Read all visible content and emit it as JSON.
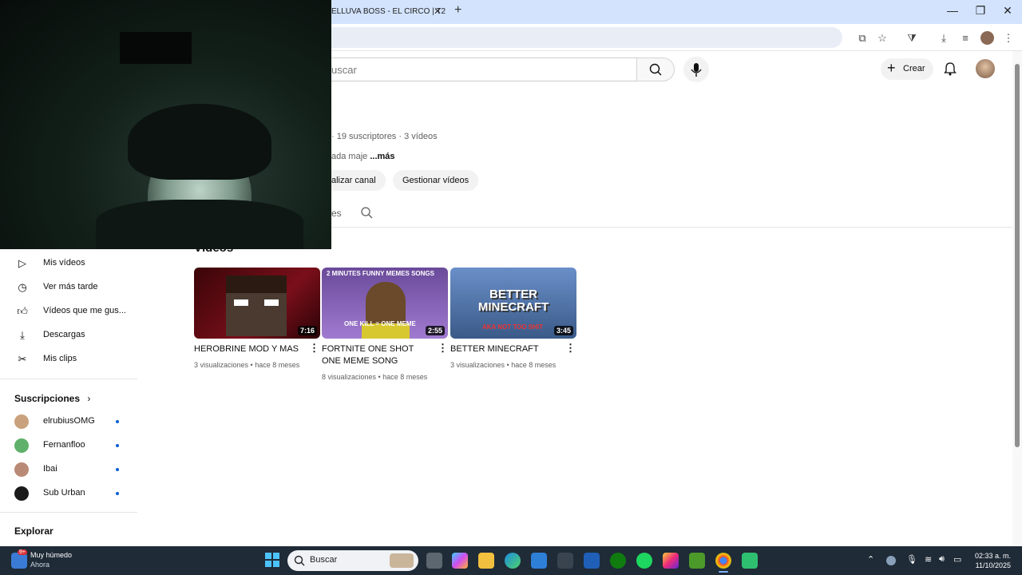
{
  "browser": {
    "tab_title": "ELLUVA BOSS - EL CIRCO | T2",
    "tab_close": "✕",
    "new_tab": "+",
    "window_controls": {
      "minimize": "—",
      "maximize": "❐",
      "close": "✕"
    }
  },
  "header": {
    "search_placeholder": "uscar",
    "create_label": "Crear"
  },
  "channel": {
    "meta": "· 19 suscriptores · 3 vídeos",
    "description": "ada maje",
    "more_label": "...más",
    "customize_label": "alizar canal",
    "manage_label": "Gestionar vídeos",
    "tab_partial": "es",
    "section_title": "Vídeos"
  },
  "sidebar": {
    "items": [
      {
        "label": "Mis vídeos",
        "icon": "play-square-icon"
      },
      {
        "label": "Ver más tarde",
        "icon": "clock-icon"
      },
      {
        "label": "Vídeos que me gus...",
        "icon": "thumbs-up-icon"
      },
      {
        "label": "Descargas",
        "icon": "download-icon"
      },
      {
        "label": "Mis clips",
        "icon": "scissors-icon"
      }
    ],
    "subscriptions_heading": "Suscripciones",
    "subscriptions": [
      {
        "name": "elrubiusOMG",
        "color": "#c9a27d"
      },
      {
        "name": "Fernanfloo",
        "color": "#5fb06a"
      },
      {
        "name": "Ibai",
        "color": "#b98a76"
      },
      {
        "name": "Sub Urban",
        "color": "#1a1a1a"
      }
    ],
    "explore_heading": "Explorar"
  },
  "videos": [
    {
      "title": "HEROBRINE MOD Y MAS",
      "duration": "7:16",
      "views": "3 visualizaciones",
      "age": "hace 8 meses",
      "thumb_color": "#5a0c14"
    },
    {
      "title": "FORTNITE ONE SHOT ONE MEME SONG",
      "duration": "2:55",
      "views": "8 visualizaciones",
      "age": "hace 8 meses",
      "thumb_color": "#7a5aa8",
      "thumb_top_text": "2 MINUTES FUNNY MEMES SONGS",
      "thumb_bottom_text": "ONE KILL = ONE MEME"
    },
    {
      "title": "BETTER MINECRAFT",
      "duration": "3:45",
      "views": "3 visualizaciones",
      "age": "hace 8 meses",
      "thumb_color": "#4b6fa5",
      "thumb_text": "BETTER MINECRAFT",
      "thumb_bottom_text": "AKA NOT TOO SHIT"
    }
  ],
  "taskbar": {
    "weather_title": "Muy húmedo",
    "weather_sub": "Ahora",
    "weather_badge": "9+",
    "search_label": "Buscar",
    "time": "02:33 a. m.",
    "date": "11/10/2025"
  }
}
